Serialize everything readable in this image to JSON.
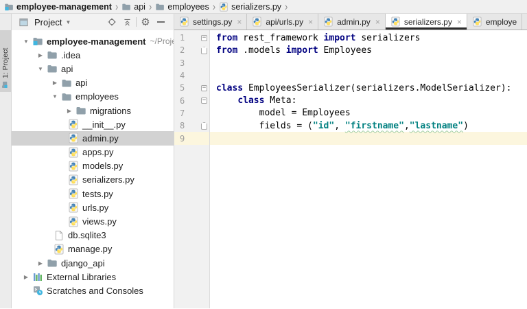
{
  "breadcrumb": {
    "separator": "›",
    "items": [
      {
        "label": "employee-management",
        "icon": "project-folder",
        "bold": true
      },
      {
        "label": "api",
        "icon": "folder",
        "bold": false
      },
      {
        "label": "employees",
        "icon": "folder",
        "bold": false
      },
      {
        "label": "serializers.py",
        "icon": "python-file",
        "bold": false
      }
    ]
  },
  "tool_strip": {
    "label": "1: Project"
  },
  "project_panel": {
    "title": "Project",
    "dropdown_glyph": "▼",
    "toolbar_icons": [
      "locate",
      "collapse-all",
      "settings",
      "hide"
    ],
    "tree": [
      {
        "label": "employee-management",
        "suffix": "~/Proje",
        "icon": "project-folder",
        "level": 0,
        "arrow": "expanded",
        "bold": true
      },
      {
        "label": ".idea",
        "icon": "folder",
        "level": 1,
        "arrow": "collapsed"
      },
      {
        "label": "api",
        "icon": "folder",
        "level": 1,
        "arrow": "expanded"
      },
      {
        "label": "api",
        "icon": "folder",
        "level": 2,
        "arrow": "collapsed"
      },
      {
        "label": "employees",
        "icon": "folder",
        "level": 2,
        "arrow": "expanded"
      },
      {
        "label": "migrations",
        "icon": "folder",
        "level": 3,
        "arrow": "collapsed"
      },
      {
        "label": "__init__.py",
        "icon": "python-file",
        "level": 3,
        "arrow": "none"
      },
      {
        "label": "admin.py",
        "icon": "python-file",
        "level": 3,
        "arrow": "none",
        "selected": true
      },
      {
        "label": "apps.py",
        "icon": "python-file",
        "level": 3,
        "arrow": "none"
      },
      {
        "label": "models.py",
        "icon": "python-file",
        "level": 3,
        "arrow": "none"
      },
      {
        "label": "serializers.py",
        "icon": "python-file",
        "level": 3,
        "arrow": "none"
      },
      {
        "label": "tests.py",
        "icon": "python-file",
        "level": 3,
        "arrow": "none"
      },
      {
        "label": "urls.py",
        "icon": "python-file",
        "level": 3,
        "arrow": "none"
      },
      {
        "label": "views.py",
        "icon": "python-file",
        "level": 3,
        "arrow": "none"
      },
      {
        "label": "db.sqlite3",
        "icon": "plain-file",
        "level": 2,
        "arrow": "none"
      },
      {
        "label": "manage.py",
        "icon": "python-file",
        "level": 2,
        "arrow": "none"
      },
      {
        "label": "django_api",
        "icon": "folder",
        "level": 1,
        "arrow": "collapsed"
      },
      {
        "label": "External Libraries",
        "icon": "libraries",
        "level": 0,
        "arrow": "collapsed"
      },
      {
        "label": "Scratches and Consoles",
        "icon": "scratches",
        "level": 0,
        "arrow": "spacer"
      }
    ]
  },
  "editor_tabs": [
    {
      "label": "settings.py",
      "icon": "python-file",
      "close": "×",
      "active": false
    },
    {
      "label": "api/urls.py",
      "icon": "python-file",
      "close": "×",
      "active": false
    },
    {
      "label": "admin.py",
      "icon": "python-file",
      "close": "×",
      "active": false
    },
    {
      "label": "serializers.py",
      "icon": "python-file",
      "close": "×",
      "active": true
    },
    {
      "label": "employe",
      "icon": "python-file",
      "close": "",
      "active": false
    }
  ],
  "editor": {
    "lines": [
      {
        "num": "1",
        "fold": "start",
        "tokens": [
          {
            "t": "from",
            "c": "kw"
          },
          {
            "t": " rest_framework ",
            "c": "plain"
          },
          {
            "t": "import",
            "c": "kw"
          },
          {
            "t": " serializers",
            "c": "plain"
          }
        ]
      },
      {
        "num": "2",
        "fold": "end",
        "tokens": [
          {
            "t": "from",
            "c": "kw"
          },
          {
            "t": " .models ",
            "c": "plain"
          },
          {
            "t": "import",
            "c": "kw"
          },
          {
            "t": " Employees",
            "c": "plain"
          }
        ]
      },
      {
        "num": "3",
        "fold": "",
        "tokens": []
      },
      {
        "num": "4",
        "fold": "",
        "tokens": []
      },
      {
        "num": "5",
        "fold": "start",
        "tokens": [
          {
            "t": "class",
            "c": "kw"
          },
          {
            "t": " EmployeesSerializer(serializers.ModelSerializer):",
            "c": "plain"
          }
        ]
      },
      {
        "num": "6",
        "fold": "start",
        "tokens": [
          {
            "t": "    ",
            "c": "plain"
          },
          {
            "t": "class",
            "c": "kw"
          },
          {
            "t": " Meta:",
            "c": "plain"
          }
        ]
      },
      {
        "num": "7",
        "fold": "",
        "tokens": [
          {
            "t": "        model = Employees",
            "c": "plain"
          }
        ]
      },
      {
        "num": "8",
        "fold": "end",
        "tokens": [
          {
            "t": "        fields = (",
            "c": "plain"
          },
          {
            "t": "\"id\"",
            "c": "str"
          },
          {
            "t": ", ",
            "c": "plain"
          },
          {
            "t": "\"firstname\"",
            "c": "str-warn"
          },
          {
            "t": ",",
            "c": "plain"
          },
          {
            "t": "\"lastname\"",
            "c": "str-warn"
          },
          {
            "t": ")",
            "c": "plain"
          }
        ]
      },
      {
        "num": "9",
        "fold": "",
        "current": true,
        "tokens": []
      }
    ]
  },
  "colors": {
    "keyword": "#000080",
    "string": "#008080",
    "current_line": "#FCF6DE",
    "tree_selection": "#D2D2D2",
    "tab_active_underline": "#2D2D2D",
    "python_blue": "#4584b6",
    "python_yellow": "#ffde57",
    "folder_gray": "#90A0AA"
  }
}
